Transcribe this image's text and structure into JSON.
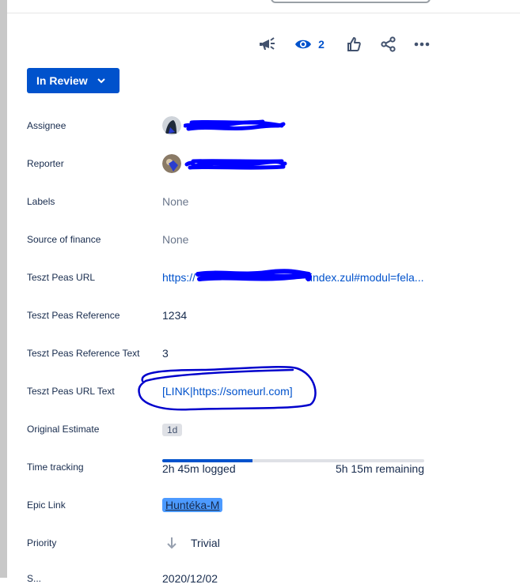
{
  "toolbar": {
    "watch_count": "2",
    "icons": [
      "megaphone-icon",
      "eye-icon",
      "thumbs-up-icon",
      "share-icon",
      "more-icon"
    ]
  },
  "status": {
    "label": "In Review"
  },
  "fields": {
    "assignee": {
      "label": "Assignee"
    },
    "reporter": {
      "label": "Reporter"
    },
    "labels": {
      "label": "Labels",
      "value": "None"
    },
    "source_of_finance": {
      "label": "Source of finance",
      "value": "None"
    },
    "teszt_peas_url": {
      "label": "Teszt Peas URL",
      "value_start": "https://",
      "value_end": "/index.zul#modul=fela..."
    },
    "teszt_peas_reference": {
      "label": "Teszt Peas Reference",
      "value": "1234"
    },
    "teszt_peas_reference_text": {
      "label": "Teszt Peas Reference Text",
      "value": "3"
    },
    "teszt_peas_url_text": {
      "label": "Teszt Peas URL Text",
      "value": "[LINK|https://someurl.com]"
    },
    "original_estimate": {
      "label": "Original Estimate",
      "value": "1d"
    },
    "time_tracking": {
      "label": "Time tracking",
      "logged": "2h 45m logged",
      "remaining": "5h 15m remaining",
      "progress_fraction": 0.344
    },
    "epic_link": {
      "label": "Epic Link",
      "value": "Huntéka-M"
    },
    "priority": {
      "label": "Priority",
      "value": "Trivial"
    },
    "partial": {
      "label": "S...",
      "value": "2020/12/02"
    }
  },
  "colors": {
    "accent": "#0052cc",
    "epic": "#4c9aff",
    "scribble": "#0000ff"
  }
}
